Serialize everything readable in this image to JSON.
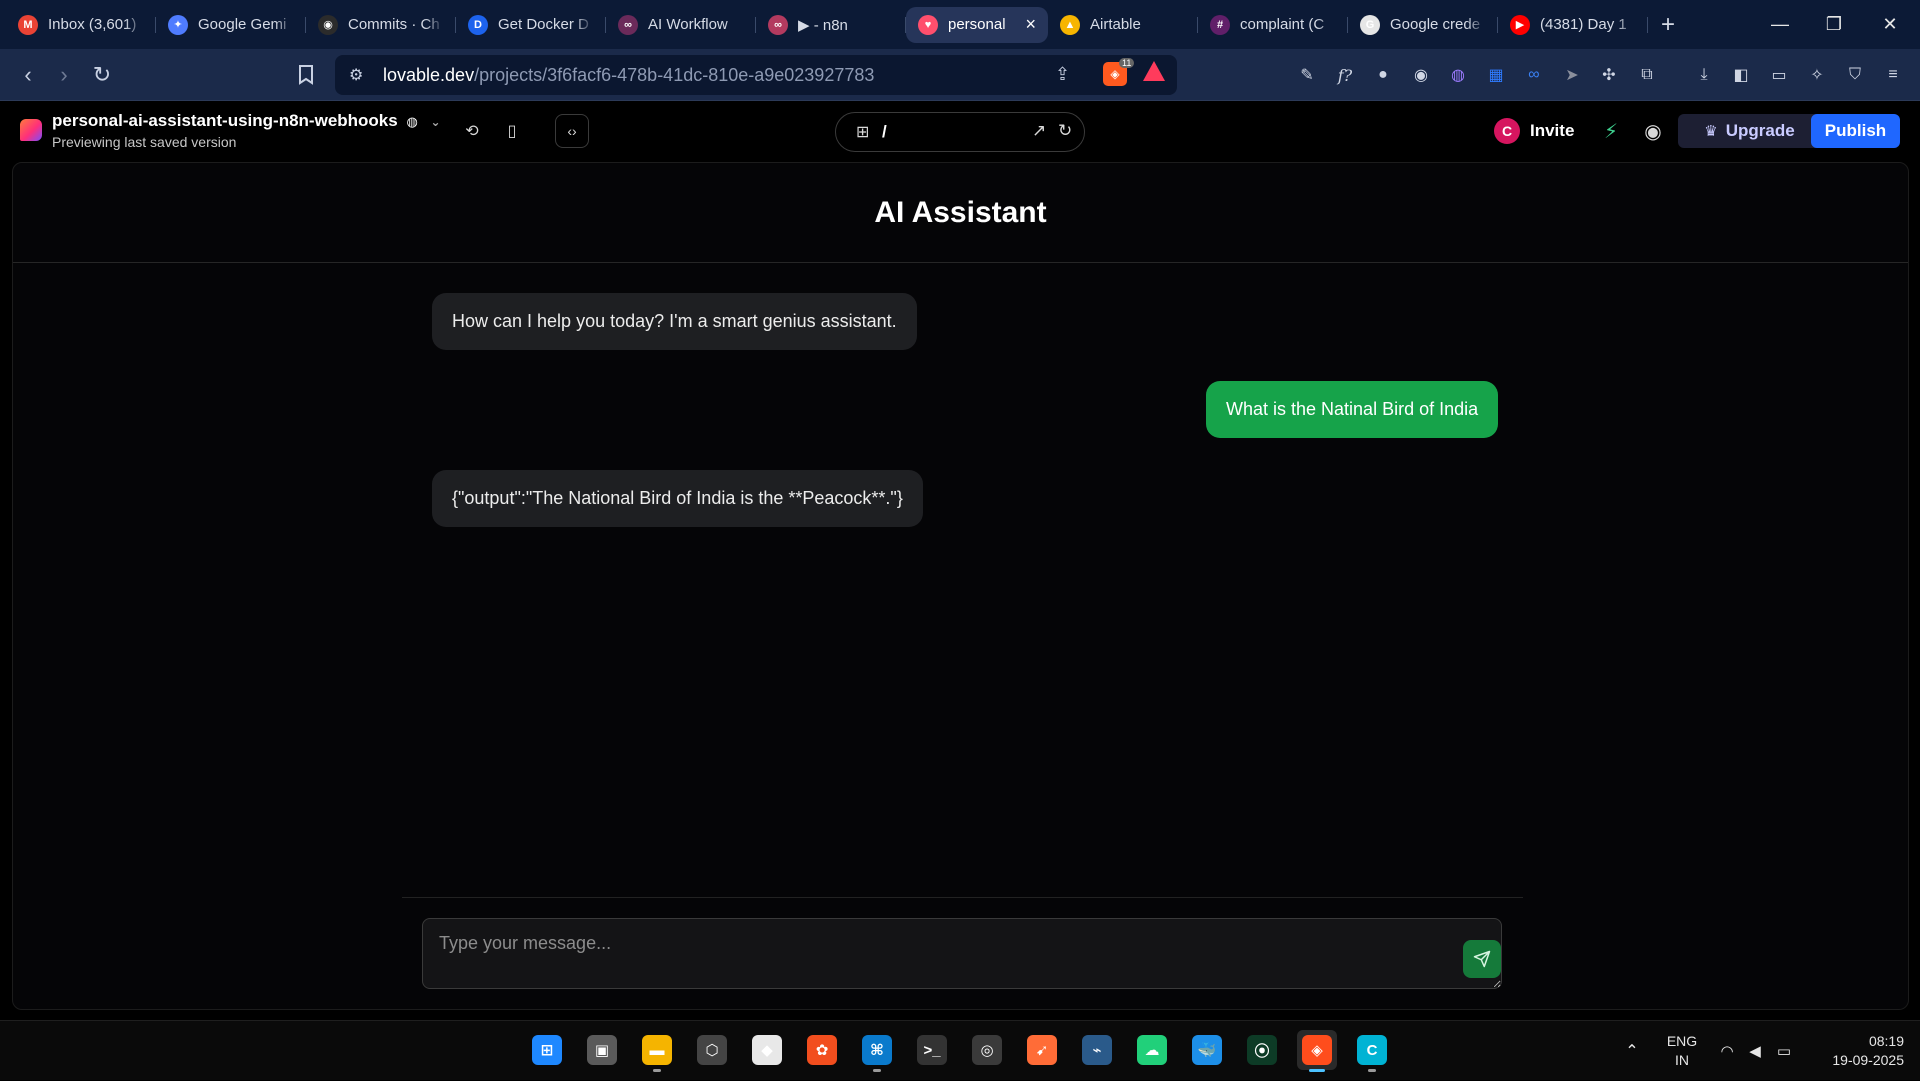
{
  "browser": {
    "tabs": [
      {
        "label": "Inbox (3,601)",
        "icon": "gmail-icon",
        "color": "#ea4335",
        "glyph": "M"
      },
      {
        "label": "Google Gemi",
        "icon": "gemini-icon",
        "color": "#4f7cff",
        "glyph": "✦"
      },
      {
        "label": "Commits · Ch",
        "icon": "github-icon",
        "color": "#2b2b2b",
        "glyph": "◉"
      },
      {
        "label": "Get Docker D",
        "icon": "docker-icon",
        "color": "#1d63ed",
        "glyph": "D"
      },
      {
        "label": "AI Workflow",
        "icon": "n8n-icon",
        "color": "#6b2a5a",
        "glyph": "∞"
      },
      {
        "label": "▶ - n8n",
        "icon": "n8n-icon",
        "color": "#b33a5f",
        "glyph": "∞"
      },
      {
        "label": "personal",
        "icon": "lovable-icon",
        "color": "#ff4f6d",
        "glyph": "♥",
        "active": true
      },
      {
        "label": "Airtable",
        "icon": "airtable-icon",
        "color": "#f7b500",
        "glyph": "▲"
      },
      {
        "label": "complaint (C",
        "icon": "slack-icon",
        "color": "#611f69",
        "glyph": "#"
      },
      {
        "label": "Google crede",
        "icon": "google-icon",
        "color": "#e6e6e6",
        "glyph": "G"
      },
      {
        "label": "(4381) Day 1",
        "icon": "youtube-icon",
        "color": "#ff0000",
        "glyph": "▶"
      }
    ],
    "new_tab": "+",
    "url_host": "lovable.dev",
    "url_path": "/projects/3f6facf6-478b-41dc-810e-a9e023927783",
    "brave_badge": "11"
  },
  "project": {
    "name": "personal-ai-assistant-using-n8n-webhooks",
    "status": "Previewing last saved version",
    "route": "/",
    "avatar_letter": "C",
    "invite_label": "Invite",
    "upgrade_label": "Upgrade",
    "publish_label": "Publish"
  },
  "chat": {
    "title": "AI Assistant",
    "messages": [
      {
        "role": "assistant",
        "text": "How can I help you today? I'm a smart genius assistant."
      },
      {
        "role": "user",
        "text": "What is the Natinal Bird of India"
      },
      {
        "role": "assistant",
        "text": "{\"output\":\"The National Bird of India is the **Peacock**.\"}"
      }
    ],
    "input_placeholder": "Type your message...",
    "input_value": ""
  },
  "taskbar": {
    "apps": [
      {
        "name": "windows-start",
        "color": "#1e88ff",
        "glyph": "⊞"
      },
      {
        "name": "task-view",
        "color": "#5a5a5a",
        "glyph": "▣"
      },
      {
        "name": "file-explorer",
        "color": "#f5b400",
        "glyph": "▬"
      },
      {
        "name": "app-unity",
        "color": "#444",
        "glyph": "⬡"
      },
      {
        "name": "app-git",
        "color": "#e8e8e8",
        "glyph": "◆"
      },
      {
        "name": "app-figma",
        "color": "#f24e1e",
        "glyph": "✿"
      },
      {
        "name": "app-vscode",
        "color": "#0a7acc",
        "glyph": "⌘"
      },
      {
        "name": "app-terminal",
        "color": "#333",
        "glyph": ">_"
      },
      {
        "name": "app-obs",
        "color": "#3a3a3a",
        "glyph": "◎"
      },
      {
        "name": "app-postman",
        "color": "#ff6c37",
        "glyph": "➹"
      },
      {
        "name": "app-mysql",
        "color": "#2a5a8a",
        "glyph": "⌁"
      },
      {
        "name": "app-datagrip",
        "color": "#21d07a",
        "glyph": "☁"
      },
      {
        "name": "app-docker",
        "color": "#1d8fe8",
        "glyph": "🐳"
      },
      {
        "name": "app-mongodb",
        "color": "#0d3b26",
        "glyph": "⦿"
      },
      {
        "name": "app-brave",
        "color": "#ff4d1c",
        "glyph": "◈"
      },
      {
        "name": "app-canva",
        "color": "#00b3d4",
        "glyph": "C"
      }
    ],
    "lang_top": "ENG",
    "lang_bottom": "IN",
    "time": "08:19",
    "date": "19-09-2025"
  }
}
